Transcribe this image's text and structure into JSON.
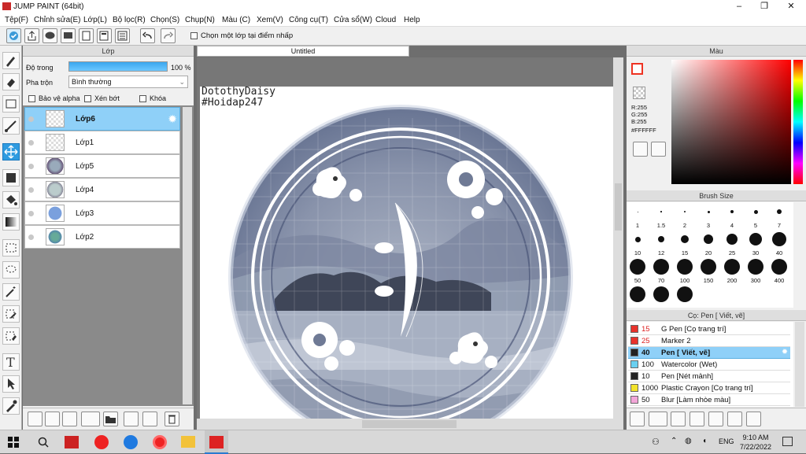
{
  "window": {
    "title": "JUMP PAINT (64bit)"
  },
  "menu": [
    "Tệp(F)",
    "Chỉnh sửa(E)",
    "Lớp(L)",
    "Bộ lọc(R)",
    "Chọn(S)",
    "Chụp(N)",
    "Màu (C)",
    "Xem(V)",
    "Công cụ(T)",
    "Cửa sổ(W)",
    "Cloud",
    "Help"
  ],
  "toolbar": {
    "select_layer_label": "Chọn một lớp tại điểm nhấp"
  },
  "layer_panel": {
    "title": "Lớp",
    "opacity_label": "Độ trong",
    "opacity_value": "100 %",
    "opacity_percent": 100,
    "blend_label": "Pha trộn",
    "blend_value": "Bình thường",
    "protect_alpha": "Bảo vệ alpha",
    "clipping": "Xén bớt",
    "lock": "Khóa",
    "layers": [
      "Lớp6",
      "Lớp1",
      "Lớp5",
      "Lớp4",
      "Lớp3",
      "Lớp2"
    ],
    "selected_index": 0
  },
  "canvas": {
    "tab": "Untitled",
    "text_line1": "DotothyDaisy",
    "text_line2": "#Hoidap247"
  },
  "color_panel": {
    "title": "Màu",
    "r": "R:255",
    "g": "G:255",
    "b": "B:255",
    "hex": "#FFFFFF"
  },
  "brush_size": {
    "title": "Brush Size",
    "sizes": [
      "1",
      "1.5",
      "2",
      "3",
      "4",
      "5",
      "7",
      "10",
      "12",
      "15",
      "20",
      "25",
      "30",
      "40",
      "50",
      "70",
      "100",
      "150",
      "200",
      "300",
      "400",
      "",
      "",
      ""
    ]
  },
  "brush_list": {
    "title": "Cọ: Pen [ Viết, vẽ]",
    "items": [
      {
        "size": "15",
        "name": "G Pen [Cọ trang trí]",
        "color": "#e8322b"
      },
      {
        "size": "25",
        "name": "Marker 2",
        "color": "#e8322b"
      },
      {
        "size": "40",
        "name": "Pen [ Viết, vẽ]",
        "color": "#222222"
      },
      {
        "size": "100",
        "name": "Watercolor (Wet)",
        "color": "#6ad0f0"
      },
      {
        "size": "10",
        "name": "Pen [Nét mảnh]",
        "color": "#222222"
      },
      {
        "size": "1000",
        "name": "Plastic Crayon [Cọ trang trí]",
        "color": "#f2e32b"
      },
      {
        "size": "50",
        "name": "Blur [Làm nhòe màu]",
        "color": "#f2a6d8"
      }
    ],
    "selected_index": 2
  },
  "taskbar": {
    "time": "9:10 AM",
    "date": "7/22/2022",
    "lang": "ENG"
  }
}
